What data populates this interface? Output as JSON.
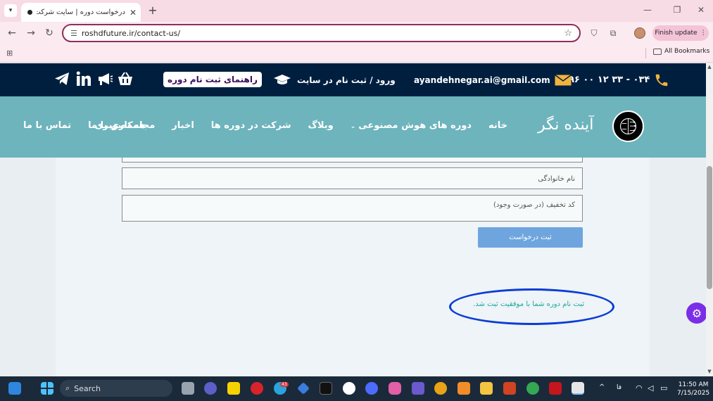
{
  "browser": {
    "tab_title": "درخواست دوره | سایت شرکت فنا...",
    "url": "roshdfuture.ir/contact-us/",
    "finish_update_label": "Finish update",
    "all_bookmarks_label": "All Bookmarks"
  },
  "site_top": {
    "phone": "۰۳۴ - ۳۳ ۱۲ ۰۰ ۹۶",
    "email": "ayandehnegar.ai@gmail.com",
    "login": "ورود / ثبت نام در سایت",
    "guide_button": "راهنمای ثبت نام دوره"
  },
  "site_nav": {
    "brand": "آینده نگر",
    "items": [
      {
        "label": "خانه"
      },
      {
        "label": "دوره های هوش مصنوعی"
      },
      {
        "label": "وبلاگ"
      },
      {
        "label": "شرکت در دوره ها"
      },
      {
        "label": "اخبار"
      },
      {
        "label": "مجله تصویری"
      },
      {
        "label": "همکاری با ما"
      },
      {
        "label": "تماس با ما"
      }
    ]
  },
  "form": {
    "family_placeholder": "نام خانوادگی",
    "discount_placeholder": "کد تخفیف (در صورت وجود)",
    "submit_label": "ثبت درخواست",
    "success_message": "ثبت نام دوره شما با موفقیت ثبت شد."
  },
  "taskbar": {
    "search_label": "Search",
    "telegram_badge": "43",
    "tray_lang": "فا",
    "time": "11:50 AM",
    "date": "7/15/2025"
  },
  "colors": {
    "top_bar": "#001f3f",
    "nav_bar": "#6db4bd",
    "submit": "#6fa5de",
    "success_text": "#1aa89b",
    "highlight": "#0a3cd6"
  }
}
